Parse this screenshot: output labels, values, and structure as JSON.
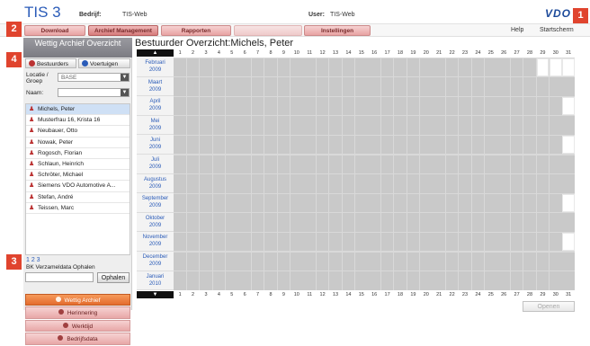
{
  "app": {
    "title": "TIS 3",
    "logo": "VDO"
  },
  "topbar": {
    "company_label": "Bedrijf:",
    "company_value": "TIS-Web",
    "user_label": "User:",
    "user_value": "TIS-Web"
  },
  "menu": {
    "tabs": [
      {
        "label": "Download"
      },
      {
        "label": "Archief Management"
      },
      {
        "label": "Rapporten"
      },
      {
        "label": "Instellingen"
      }
    ],
    "links": {
      "help": "Help",
      "home": "Startscherm"
    }
  },
  "badges": {
    "b1": "1",
    "b2": "2",
    "b3": "3",
    "b4": "4",
    "b5": "5"
  },
  "sidebar": {
    "title": "Wettig Archief Overzicht",
    "tab_drivers": "Bestuurders",
    "tab_vehicles": "Voertuigen",
    "location_label": "Locatie / Groep",
    "location_value": "BASE",
    "name_label": "Naam:",
    "name_value": "",
    "drivers": [
      "Michels, Peter",
      "Musterfrau 16, Krista 16",
      "Neubauer, Otto",
      "Nowak, Peter",
      "Rogosch, Florian",
      "Schlaun, Heinrich",
      "Schröter, Michael",
      "Siemens VDO Automotive A...",
      "Stefan, André",
      "Teissen, Marc"
    ],
    "pager": "1 2 3",
    "bk_label": "BK Verzameldata Ophalen",
    "fetch_button": "Ophalen",
    "nav": [
      {
        "label": "Wettig Archief"
      },
      {
        "label": "Herinnering"
      },
      {
        "label": "Werktijd"
      },
      {
        "label": "Bedrijfsdata"
      }
    ]
  },
  "main": {
    "title": "Bestuurder Overzicht:Michels, Peter",
    "nav_up": "▲",
    "nav_down": "▼",
    "days": [
      "1",
      "2",
      "3",
      "4",
      "5",
      "6",
      "7",
      "8",
      "9",
      "10",
      "11",
      "12",
      "13",
      "14",
      "15",
      "16",
      "17",
      "18",
      "19",
      "20",
      "21",
      "22",
      "23",
      "24",
      "25",
      "26",
      "27",
      "28",
      "29",
      "30",
      "31"
    ],
    "months": [
      {
        "name": "Februari",
        "year": "2009"
      },
      {
        "name": "Maart",
        "year": "2009"
      },
      {
        "name": "April",
        "year": "2009"
      },
      {
        "name": "Mei",
        "year": "2009"
      },
      {
        "name": "Juni",
        "year": "2009"
      },
      {
        "name": "Juli",
        "year": "2009"
      },
      {
        "name": "Augustus",
        "year": "2009"
      },
      {
        "name": "September",
        "year": "2009"
      },
      {
        "name": "Oktober",
        "year": "2009"
      },
      {
        "name": "November",
        "year": "2009"
      },
      {
        "name": "December",
        "year": "2009"
      },
      {
        "name": "Januari",
        "year": "2010"
      }
    ],
    "open_button": "Openen"
  }
}
